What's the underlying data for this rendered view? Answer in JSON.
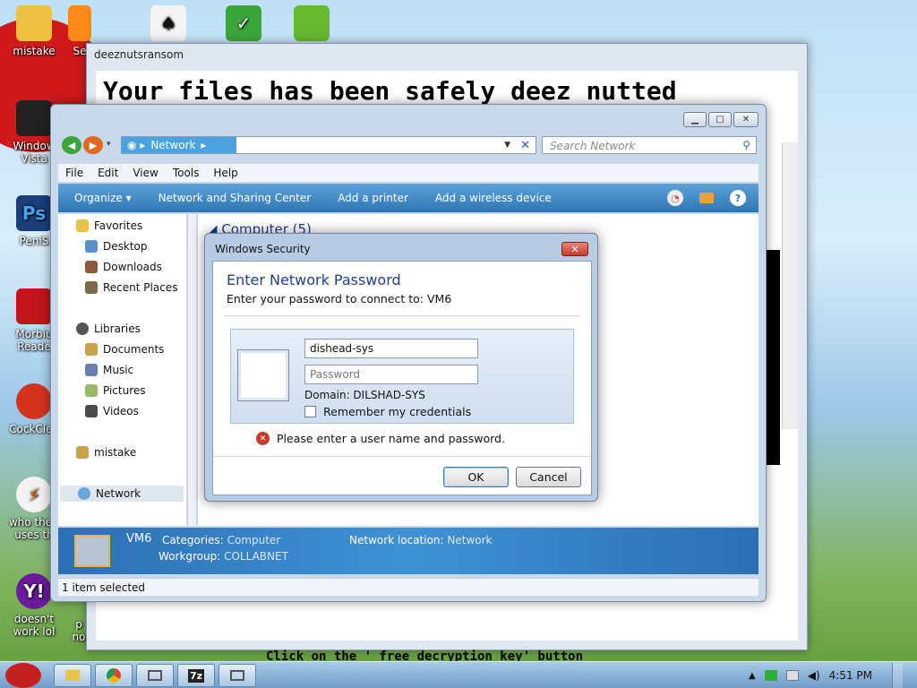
{
  "desktop": {
    "icons": [
      {
        "label": "mistake"
      },
      {
        "label": "Se"
      },
      {
        "label": "Window"
      },
      {
        "label": "Vista"
      },
      {
        "label": "PeniS"
      },
      {
        "label": "Morbiu"
      },
      {
        "label": "Reade"
      },
      {
        "label": "CockClea"
      },
      {
        "label": "who the f"
      },
      {
        "label": "uses th"
      },
      {
        "label": "doesn't"
      },
      {
        "label": "work lol"
      },
      {
        "label": "p"
      },
      {
        "label": "no"
      }
    ]
  },
  "ransom_window": {
    "title": "deeznutsransom",
    "heading": "Your files has been safely deez nutted",
    "footer_text": "Click on the ' free decryption key' button"
  },
  "explorer": {
    "address": {
      "root": "Network"
    },
    "search_placeholder": "Search Network",
    "menu": [
      "File",
      "Edit",
      "View",
      "Tools",
      "Help"
    ],
    "commands": [
      "Organize ▾",
      "Network and Sharing Center",
      "Add a printer",
      "Add a wireless device"
    ],
    "nav": {
      "favorites": "Favorites",
      "desktop": "Desktop",
      "downloads": "Downloads",
      "recent": "Recent Places",
      "libraries": "Libraries",
      "documents": "Documents",
      "music": "Music",
      "pictures": "Pictures",
      "videos": "Videos",
      "user": "mistake",
      "network": "Network"
    },
    "group_header": "Computer (5)",
    "details": {
      "name": "VM6",
      "categories_key": "Categories:",
      "categories_val": "Computer",
      "workgroup_key": "Workgroup:",
      "workgroup_val": "COLLABNET",
      "location_key": "Network location:",
      "location_val": "Network"
    },
    "status": "1 item selected"
  },
  "dialog": {
    "title": "Windows Security",
    "heading": "Enter Network Password",
    "subtitle": "Enter your password to connect to: VM6",
    "username_value": "dishead-sys",
    "password_placeholder": "Password",
    "domain": "Domain: DILSHAD-SYS",
    "remember": "Remember my credentials",
    "error": "Please enter a user name and password.",
    "ok": "OK",
    "cancel": "Cancel"
  },
  "taskbar": {
    "clock": "4:51 PM",
    "sevenzip": "7z"
  }
}
